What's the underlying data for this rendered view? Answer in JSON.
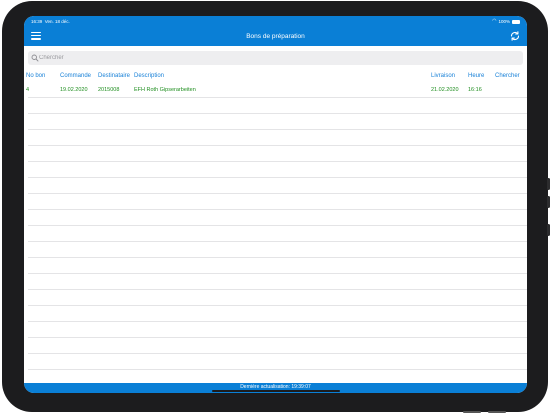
{
  "status": {
    "time": "16:39",
    "date": "Ven. 18 déc.",
    "battery": "100%"
  },
  "navbar": {
    "title": "Bons de préparation",
    "menu_icon": "hamburger-menu-icon",
    "refresh_icon": "refresh-icon"
  },
  "search": {
    "placeholder": "Chercher",
    "value": ""
  },
  "table": {
    "headers": {
      "no_bon": "No bon",
      "commande": "Commande",
      "destinataire": "Destinataire",
      "description": "Description",
      "livraison": "Livraison",
      "heure": "Heure",
      "chercher": "Chercher"
    },
    "rows": [
      {
        "no_bon": "4",
        "commande": "19.02.2020",
        "destinataire": "2015008",
        "description": "EFH Roth Gipserarbeiten",
        "livraison": "21.02.2020",
        "heure": "16:16"
      }
    ]
  },
  "footer": {
    "last_update": "Dernière actualisation: 19:39:07"
  },
  "colors": {
    "accent": "#0a7fd6",
    "header_text": "#1a82d8",
    "row_text": "#1f8e1f"
  }
}
